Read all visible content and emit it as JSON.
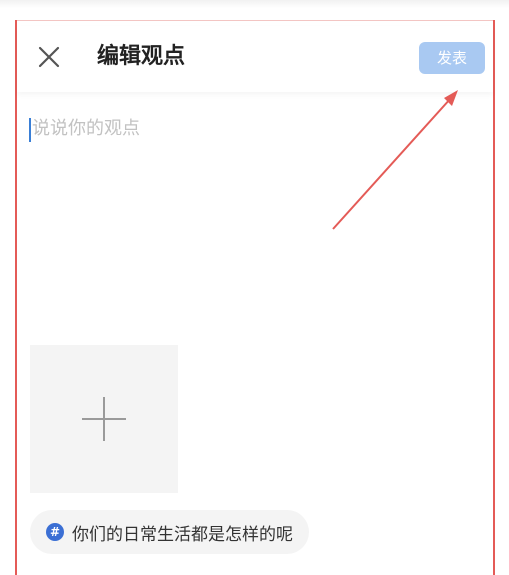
{
  "header": {
    "title": "编辑观点",
    "publish_label": "发表"
  },
  "editor": {
    "placeholder": "说说你的观点",
    "value": ""
  },
  "topic": {
    "hash_symbol": "#",
    "text": "你们的日常生活都是怎样的呢"
  },
  "colors": {
    "publish_button_bg": "#a9c9f2",
    "annotation_red": "#e45b57",
    "topic_icon_blue": "#3b6fd4"
  },
  "icons": {
    "close": "close-icon",
    "add": "plus-icon",
    "topic": "hashtag-icon"
  }
}
